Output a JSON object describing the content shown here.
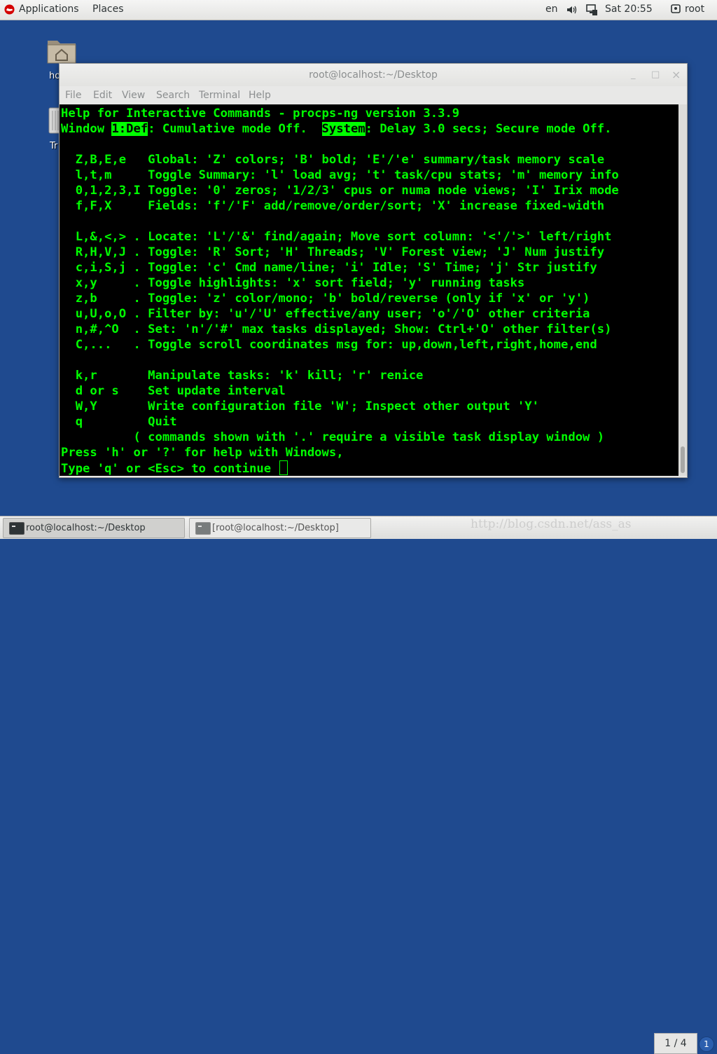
{
  "top_panel": {
    "applications": "Applications",
    "places": "Places",
    "language": "en",
    "clock": "Sat 20:55",
    "user": "root"
  },
  "desktop": {
    "home_label": "ho",
    "trash_label": "Tr"
  },
  "window": {
    "title": "root@localhost:~/Desktop",
    "controls": {
      "minimize": "_",
      "maximize": "□",
      "close": "×"
    },
    "menu": [
      "File",
      "Edit",
      "View",
      "Search",
      "Terminal",
      "Help"
    ]
  },
  "terminal": {
    "header1": "Help for Interactive Commands - procps-ng version 3.3.9",
    "header2_a": "Window ",
    "header2_hl1": "1:Def",
    "header2_b": ": Cumulative mode Off.  ",
    "header2_hl2": "System",
    "header2_c": ": Delay 3.0 secs; Secure mode Off.",
    "lines": [
      "  Z,B,E,e   Global: 'Z' colors; 'B' bold; 'E'/'e' summary/task memory scale",
      "  l,t,m     Toggle Summary: 'l' load avg; 't' task/cpu stats; 'm' memory info",
      "  0,1,2,3,I Toggle: '0' zeros; '1/2/3' cpus or numa node views; 'I' Irix mode",
      "  f,F,X     Fields: 'f'/'F' add/remove/order/sort; 'X' increase fixed-width",
      "",
      "  L,&,<,> . Locate: 'L'/'&' find/again; Move sort column: '<'/'>' left/right",
      "  R,H,V,J . Toggle: 'R' Sort; 'H' Threads; 'V' Forest view; 'J' Num justify",
      "  c,i,S,j . Toggle: 'c' Cmd name/line; 'i' Idle; 'S' Time; 'j' Str justify",
      "  x,y     . Toggle highlights: 'x' sort field; 'y' running tasks",
      "  z,b     . Toggle: 'z' color/mono; 'b' bold/reverse (only if 'x' or 'y')",
      "  u,U,o,O . Filter by: 'u'/'U' effective/any user; 'o'/'O' other criteria",
      "  n,#,^O  . Set: 'n'/'#' max tasks displayed; Show: Ctrl+'O' other filter(s)",
      "  C,...   . Toggle scroll coordinates msg for: up,down,left,right,home,end",
      "",
      "  k,r       Manipulate tasks: 'k' kill; 'r' renice",
      "  d or s    Set update interval",
      "  W,Y       Write configuration file 'W'; Inspect other output 'Y'",
      "  q         Quit",
      "          ( commands shown with '.' require a visible task display window )",
      "Press 'h' or '?' for help with Windows,"
    ],
    "prompt": "Type 'q' or <Esc> to continue "
  },
  "taskbar": {
    "task1": "root@localhost:~/Desktop",
    "task2": "[root@localhost:~/Desktop]",
    "watermark": "http://blog.csdn.net/ass_as",
    "pager": "1 / 4",
    "notifications": "1"
  },
  "colors": {
    "terminal_fg": "#00ff00",
    "terminal_bg": "#000000",
    "desktop_bg": "#1f4a8f"
  }
}
